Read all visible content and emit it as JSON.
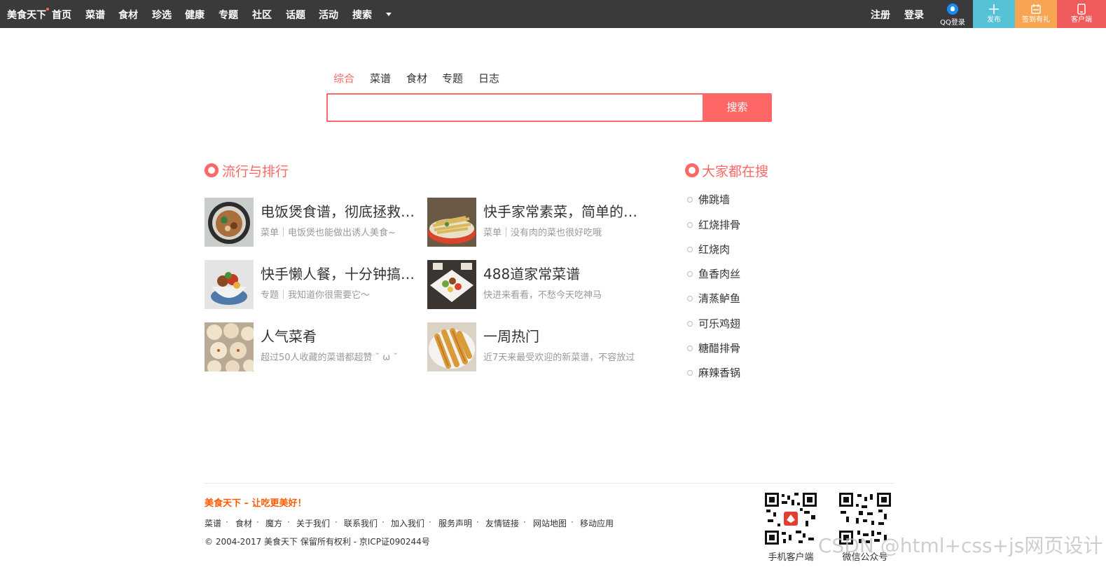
{
  "brand": {
    "logo": "美食天下",
    "accent": "#ff6767",
    "topbar_bg": "#3a3a3a"
  },
  "nav": {
    "items": [
      "首页",
      "菜谱",
      "食材",
      "珍选",
      "健康",
      "专题",
      "社区",
      "话题",
      "活动",
      "搜索"
    ],
    "register": "注册",
    "login": "登录",
    "qq_login": "QQ登录",
    "publish": "发布",
    "signin_gift": "签到有礼",
    "client": "客户端"
  },
  "search": {
    "tabs": [
      "综合",
      "菜谱",
      "食材",
      "专题",
      "日志"
    ],
    "active_tab": "综合",
    "query": "",
    "button": "搜索"
  },
  "ranking": {
    "title": "流行与排行",
    "cards": [
      {
        "title": "电饭煲食谱，彻底拯救手残党",
        "subtitle": "菜单｜电饭煲也能做出诱人美食~"
      },
      {
        "title": "快手家常素菜，简单的美味",
        "subtitle": "菜单｜没有肉的菜也很好吃哦"
      },
      {
        "title": "快手懒人餐，十分钟搞定！",
        "subtitle": "专题｜我知道你很需要它～"
      },
      {
        "title": "488道家常菜谱",
        "subtitle": "快进来看看，不愁今天吃神马"
      },
      {
        "title": "人气菜肴",
        "subtitle": "超过50人收藏的菜谱都超赞 ˘ ω ˘"
      },
      {
        "title": "一周热门",
        "subtitle": "近7天来最受欢迎的新菜谱，不容放过"
      }
    ]
  },
  "hot": {
    "title": "大家都在搜",
    "items": [
      "佛跳墙",
      "红烧排骨",
      "红烧肉",
      "鱼香肉丝",
      "清蒸鲈鱼",
      "可乐鸡翅",
      "糖醋排骨",
      "麻辣香锅"
    ]
  },
  "footer": {
    "slogan": "美食天下 – 让吃更美好！",
    "links": [
      "菜谱",
      "食材",
      "魔方",
      "关于我们",
      "联系我们",
      "加入我们",
      "服务声明",
      "友情链接",
      "网站地图",
      "移动应用"
    ],
    "copyright": "© 2004-2017 美食天下 保留所有权利 - 京ICP证090244号",
    "qr_app": "手机客户端",
    "qr_wechat": "微信公众号",
    "watermark": "CSDN @html+css+js网页设计"
  }
}
